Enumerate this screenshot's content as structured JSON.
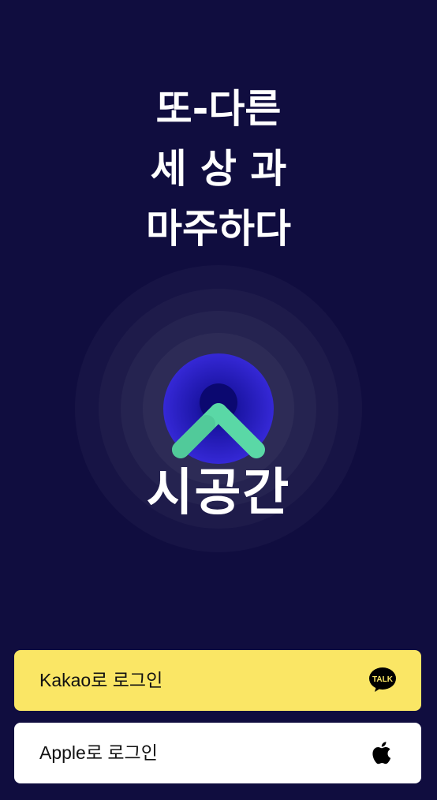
{
  "headline": {
    "line1": "또-다른",
    "line2": "세 상 과",
    "line3": "마주하다"
  },
  "logo": {
    "wordmark": "시공간",
    "mark_color": "#5ad8a6",
    "glow_color": "#2a22c9"
  },
  "buttons": {
    "kakao": {
      "label": "Kakao로 로그인",
      "icon": "kakao-talk-icon",
      "icon_text": "TALK",
      "background": "#fae665"
    },
    "apple": {
      "label": "Apple로 로그인",
      "icon": "apple-icon",
      "background": "#ffffff"
    }
  },
  "colors": {
    "background": "#100d3f",
    "text": "#ffffff"
  }
}
